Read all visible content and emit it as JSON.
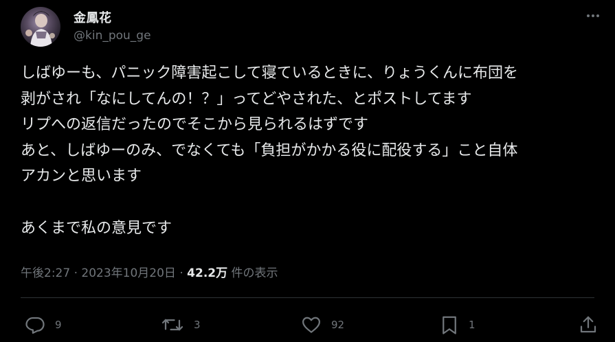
{
  "tweet": {
    "author": {
      "display_name": "金鳳花",
      "handle": "@kin_pou_ge"
    },
    "text_lines": [
      "しばゆーも、パニック障害起こして寝ているときに、りょうくんに布団を",
      "剥がされ「なにしてんの！？」ってどやされた、とポストしてます",
      "リプへの返信だったのでそこから見られるはずです",
      "あと、しばゆーのみ、でなくても「負担がかかる役に配役する」こと自体",
      "アカンと思います",
      "",
      "あくまで私の意見です"
    ],
    "meta": {
      "time": "午後2:27",
      "separator": "·",
      "date": "2023年10月20日",
      "views_count": "42.2万",
      "views_label": "件の表示"
    },
    "actions": {
      "reply_count": "9",
      "repost_count": "3",
      "like_count": "92",
      "bookmark_count": "1"
    }
  },
  "icons": {
    "more": "more-horizontal-icon",
    "reply": "reply-icon",
    "repost": "repost-icon",
    "like": "heart-icon",
    "bookmark": "bookmark-icon",
    "share": "share-icon"
  },
  "colors": {
    "background": "#000000",
    "text_primary": "#e7e9ea",
    "text_secondary": "#71767b",
    "divider": "#2f3336"
  }
}
